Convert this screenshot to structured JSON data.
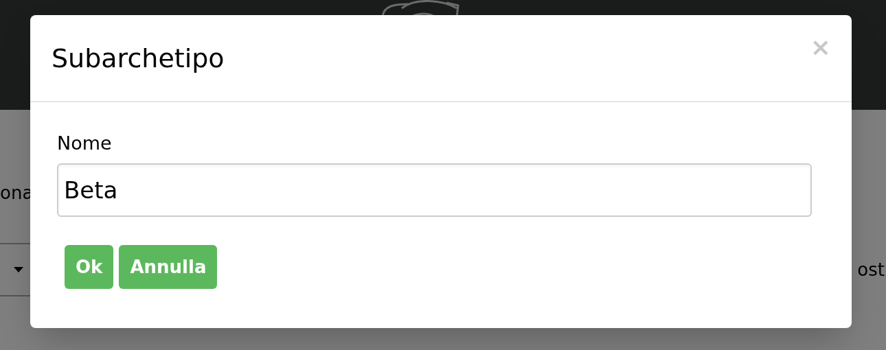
{
  "background": {
    "label_fragment": "ona",
    "right_fragment": "ost"
  },
  "dialog": {
    "title": "Subarchetipo",
    "close": "×",
    "fields": [
      {
        "label": "Nome",
        "value": "Beta"
      }
    ],
    "buttons": [
      "Ok",
      "Annulla"
    ]
  }
}
